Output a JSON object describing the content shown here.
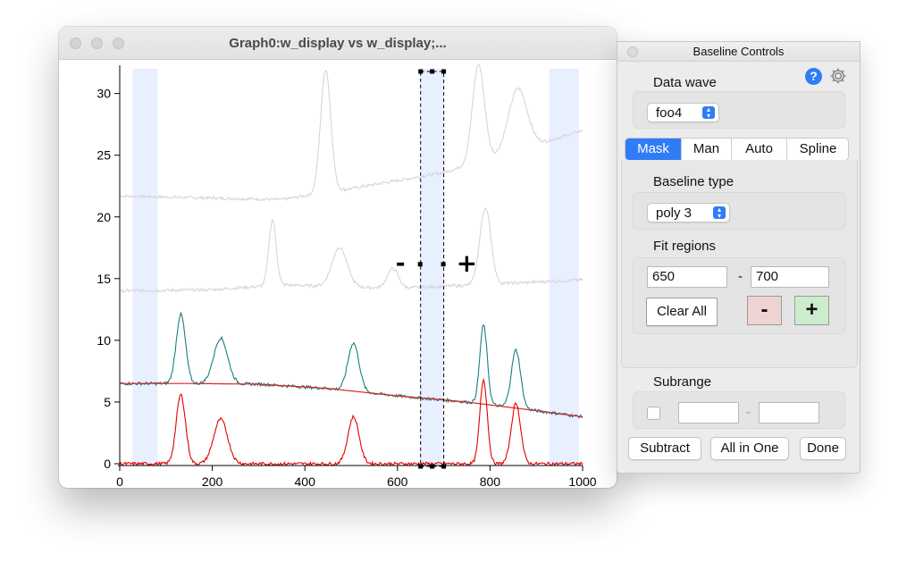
{
  "graph_window": {
    "title": "Graph0:w_display vs w_display;..."
  },
  "chart_data": {
    "type": "line",
    "xlim": [
      0,
      1000
    ],
    "ylim": [
      0,
      32
    ],
    "x_ticks": [
      0,
      200,
      400,
      600,
      800,
      1000
    ],
    "y_ticks": [
      0,
      5,
      10,
      15,
      20,
      25,
      30
    ],
    "x_tick_labels": [
      "0",
      "200",
      "400",
      "600",
      "800",
      "1000"
    ],
    "y_tick_labels": [
      "0",
      "5",
      "10",
      "15",
      "20",
      "25",
      "30"
    ],
    "shaded_regions": [
      {
        "x0": 28,
        "x1": 82
      },
      {
        "x0": 928,
        "x1": 992
      },
      {
        "x0": 650,
        "x1": 700,
        "selected": true
      }
    ],
    "series": [
      {
        "color": "#d6d6d6",
        "baseline": [
          [
            0,
            21.7
          ],
          [
            350,
            21.4
          ],
          [
            500,
            22.3
          ],
          [
            700,
            23.6
          ],
          [
            1000,
            27.0
          ]
        ],
        "peaks": [
          [
            445,
            10.0,
            11
          ],
          [
            775,
            7.9,
            13
          ],
          [
            860,
            5.0,
            20
          ]
        ]
      },
      {
        "color": "#d6d6d6",
        "baseline": [
          [
            0,
            14.0
          ],
          [
            200,
            14.1
          ],
          [
            350,
            14.5
          ],
          [
            600,
            14.2
          ],
          [
            1000,
            14.9
          ]
        ],
        "peaks": [
          [
            330,
            5.3,
            8
          ],
          [
            475,
            3.2,
            16
          ],
          [
            590,
            1.6,
            12
          ],
          [
            790,
            6.2,
            12
          ]
        ]
      },
      {
        "color": "#1a7f7f",
        "baseline": [
          [
            0,
            6.5
          ],
          [
            150,
            6.5
          ],
          [
            300,
            6.45
          ],
          [
            450,
            6.1
          ],
          [
            600,
            5.5
          ],
          [
            750,
            5.0
          ],
          [
            900,
            4.3
          ],
          [
            1000,
            3.8
          ]
        ],
        "peaks": [
          [
            132,
            5.6,
            10
          ],
          [
            218,
            3.7,
            15
          ],
          [
            505,
            3.9,
            12
          ],
          [
            786,
            6.4,
            8
          ],
          [
            856,
            4.7,
            10
          ]
        ]
      },
      {
        "color": "#e02020",
        "baseline": [
          [
            0,
            6.5
          ],
          [
            150,
            6.5
          ],
          [
            300,
            6.45
          ],
          [
            450,
            6.1
          ],
          [
            600,
            5.5
          ],
          [
            750,
            5.0
          ],
          [
            900,
            4.3
          ],
          [
            1000,
            3.8
          ]
        ],
        "peaks": []
      },
      {
        "color": "#e00000",
        "baseline": [
          [
            0,
            0.0
          ],
          [
            1000,
            0.0
          ]
        ],
        "peaks": [
          [
            132,
            5.6,
            10
          ],
          [
            218,
            3.6,
            15
          ],
          [
            505,
            3.8,
            12
          ],
          [
            786,
            6.8,
            8
          ],
          [
            856,
            4.9,
            10
          ]
        ]
      }
    ],
    "region_markers": [
      "-",
      "+"
    ]
  },
  "panel": {
    "title": "Baseline Controls",
    "data_wave_label": "Data wave",
    "data_wave_value": "foo4",
    "tabs": [
      "Mask",
      "Man",
      "Auto",
      "Spline"
    ],
    "active_tab": "Mask",
    "baseline_type_label": "Baseline type",
    "baseline_type_value": "poly 3",
    "fit_regions_label": "Fit regions",
    "fit_from": "650",
    "fit_sep": "-",
    "fit_to": "700",
    "clear_all": "Clear All",
    "minus": "-",
    "plus": "+",
    "subrange_label": "Subrange",
    "subrange_from": "",
    "subrange_sep": "-",
    "subrange_to": "",
    "subtract": "Subtract",
    "all_in_one": "All in One",
    "done": "Done"
  },
  "colors": {
    "accent": "#2f7cf6",
    "minus_button": "#efd3d3",
    "plus_button": "#cdeccd",
    "shade": "#e8efff"
  }
}
